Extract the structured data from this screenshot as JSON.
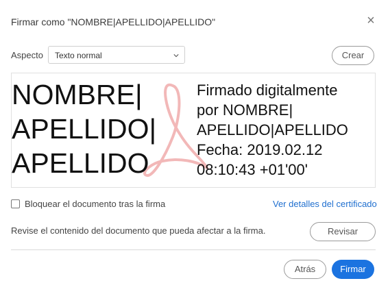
{
  "dialog": {
    "title": "Firmar como \"NOMBRE|APELLIDO|APELLIDO\"",
    "close_glyph": "×"
  },
  "appearance": {
    "label": "Aspecto",
    "selected": "Texto normal",
    "create_label": "Crear"
  },
  "preview": {
    "name_lines": [
      "NOMBRE|",
      "APELLIDO|",
      "APELLIDO"
    ],
    "info_lines": [
      "Firmado digitalmente",
      "por NOMBRE|",
      "APELLIDO|APELLIDO",
      "Fecha: 2019.02.12",
      "08:10:43 +01'00'"
    ],
    "watermark_icon": "adobe-acrobat-icon"
  },
  "options": {
    "lock_label": "Bloquear el documento tras la firma",
    "lock_checked": false,
    "cert_link": "Ver detalles del certificado"
  },
  "review": {
    "text": "Revise el contenido del documento que pueda afectar a la firma.",
    "button": "Revisar"
  },
  "footer": {
    "back": "Atrás",
    "sign": "Firmar"
  },
  "colors": {
    "accent": "#1b73e0",
    "link": "#1f6fcf",
    "watermark": "#f2b8b8"
  }
}
